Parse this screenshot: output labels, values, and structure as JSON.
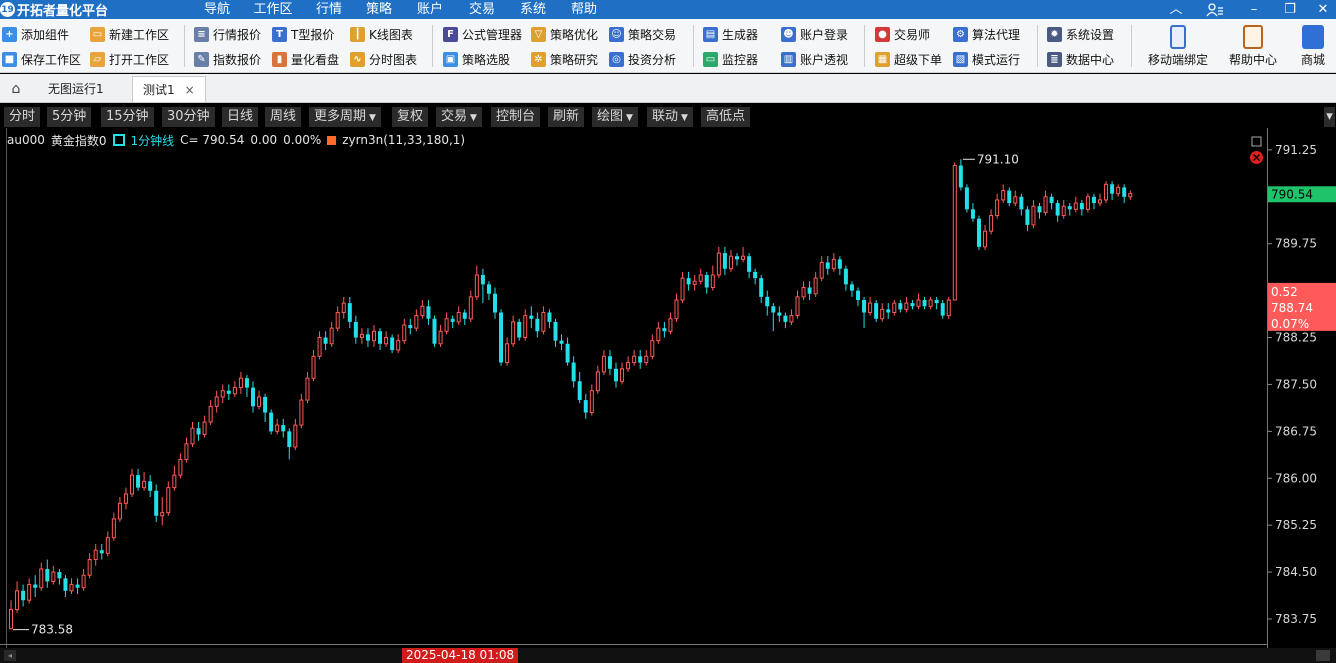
{
  "app": {
    "logo": "19",
    "title": "开拓者量化平台"
  },
  "menu": [
    {
      "label": "导航",
      "active": true
    },
    {
      "label": "工作区",
      "active": false
    },
    {
      "label": "行情",
      "active": false
    },
    {
      "label": "策略",
      "active": false
    },
    {
      "label": "账户",
      "active": false
    },
    {
      "label": "交易",
      "active": false
    },
    {
      "label": "系统",
      "active": false
    },
    {
      "label": "帮助",
      "active": false
    }
  ],
  "ribbon": {
    "add_component": "添加组件",
    "save_workspace": "保存工作区",
    "new_workspace": "新建工作区",
    "open_workspace": "打开工作区",
    "quote_report": "行情报价",
    "index_quote": "指数报价",
    "t_quote": "T型报价",
    "quant_board": "量化看盘",
    "kline_chart": "K线图表",
    "time_chart": "分时图表",
    "formula_manager": "公式管理器",
    "strategy_pick": "策略选股",
    "strategy_optimize": "策略优化",
    "strategy_research": "策略研究",
    "strategy_trade": "策略交易",
    "invest_analysis": "投资分析",
    "generator": "生成器",
    "monitor": "监控器",
    "account_login": "账户登录",
    "account_view": "账户透视",
    "trader": "交易师",
    "super_order": "超级下单",
    "algo_agent": "算法代理",
    "mode_run": "模式运行",
    "system_settings": "系统设置",
    "data_center": "数据中心",
    "mobile_bind": "移动端绑定",
    "help_center": "帮助中心",
    "store": "商城"
  },
  "tabs": [
    {
      "label": "无图运行1",
      "active": false
    },
    {
      "label": "测试1",
      "active": true,
      "close": "×"
    }
  ],
  "chart_toolbar": [
    "分时",
    "5分钟",
    "15分钟",
    "30分钟",
    "日线",
    "周线",
    "更多周期",
    "复权",
    "交易",
    "控制台",
    "刷新",
    "绘图",
    "联动",
    "高低点"
  ],
  "dropdown_marker": "▼",
  "info": {
    "symbol": "au000",
    "name": "黄金指数0",
    "period": "1分钟线",
    "close_label": "C= 790.54",
    "change": "0.00",
    "change_pct": "0.00%",
    "indicator": "zyrn3n(11,33,180,1)"
  },
  "colors": {
    "up": "#ff5a5a",
    "down": "#23e0e8",
    "last_price_bg": "#1fc46a",
    "cursor_box_bg": "#ff5a5a",
    "date_badge": "#d21c1c"
  },
  "chart_data": {
    "type": "candlestick",
    "x_label_visible": "2025-04-18 01:08",
    "ylim": [
      783.35,
      791.6
    ],
    "yticks": [
      "791.25",
      "789.75",
      "788.25",
      "787.50",
      "786.75",
      "786.00",
      "785.25",
      "784.50",
      "783.75"
    ],
    "ytick_values": [
      791.25,
      789.75,
      788.25,
      787.5,
      786.75,
      786.0,
      785.25,
      784.5,
      783.75
    ],
    "last_price": "790.54",
    "last_price_value": 790.54,
    "cursor_box": [
      "0.52",
      "788.74",
      "0.07%"
    ],
    "cursor_value": 788.74,
    "high_label": "791.10",
    "high_value": 791.1,
    "low_label": "783.58",
    "low_value": 783.58,
    "candles": [
      [
        783.6,
        783.9,
        783.58,
        784.05
      ],
      [
        783.9,
        784.2,
        783.85,
        784.35
      ],
      [
        784.2,
        784.05,
        783.95,
        784.3
      ],
      [
        784.05,
        784.3,
        784.0,
        784.4
      ],
      [
        784.3,
        784.25,
        784.1,
        784.45
      ],
      [
        784.25,
        784.55,
        784.2,
        784.65
      ],
      [
        784.55,
        784.35,
        784.25,
        784.7
      ],
      [
        784.35,
        784.5,
        784.3,
        784.6
      ],
      [
        784.5,
        784.4,
        784.3,
        784.55
      ],
      [
        784.4,
        784.2,
        784.1,
        784.45
      ],
      [
        784.2,
        784.3,
        784.15,
        784.4
      ],
      [
        784.3,
        784.25,
        784.15,
        784.4
      ],
      [
        784.25,
        784.45,
        784.2,
        784.55
      ],
      [
        784.45,
        784.7,
        784.4,
        784.8
      ],
      [
        784.7,
        784.85,
        784.6,
        784.95
      ],
      [
        784.85,
        784.8,
        784.7,
        784.95
      ],
      [
        784.8,
        785.05,
        784.75,
        785.15
      ],
      [
        785.05,
        785.35,
        785.0,
        785.45
      ],
      [
        785.35,
        785.6,
        785.3,
        785.7
      ],
      [
        785.6,
        785.75,
        785.5,
        785.85
      ],
      [
        785.75,
        786.05,
        785.7,
        786.15
      ],
      [
        786.05,
        785.85,
        785.8,
        786.15
      ],
      [
        785.85,
        785.95,
        785.8,
        786.1
      ],
      [
        785.95,
        785.8,
        785.7,
        786.05
      ],
      [
        785.8,
        785.4,
        785.3,
        785.9
      ],
      [
        785.4,
        785.45,
        785.25,
        785.7
      ],
      [
        785.45,
        785.85,
        785.4,
        785.95
      ],
      [
        785.85,
        786.05,
        785.8,
        786.2
      ],
      [
        786.05,
        786.3,
        786.0,
        786.4
      ],
      [
        786.3,
        786.55,
        786.25,
        786.65
      ],
      [
        786.55,
        786.8,
        786.5,
        786.9
      ],
      [
        786.8,
        786.7,
        786.6,
        786.9
      ],
      [
        786.7,
        786.9,
        786.65,
        787.0
      ],
      [
        786.9,
        787.15,
        786.85,
        787.25
      ],
      [
        787.15,
        787.3,
        787.05,
        787.4
      ],
      [
        787.3,
        787.4,
        787.2,
        787.5
      ],
      [
        787.4,
        787.35,
        787.25,
        787.5
      ],
      [
        787.35,
        787.45,
        787.3,
        787.55
      ],
      [
        787.45,
        787.6,
        787.35,
        787.7
      ],
      [
        787.6,
        787.45,
        787.3,
        787.65
      ],
      [
        787.45,
        787.15,
        787.05,
        787.55
      ],
      [
        787.15,
        787.3,
        787.1,
        787.4
      ],
      [
        787.3,
        787.05,
        786.9,
        787.35
      ],
      [
        787.05,
        786.75,
        786.7,
        787.1
      ],
      [
        786.75,
        786.85,
        786.7,
        786.95
      ],
      [
        786.85,
        786.75,
        786.65,
        786.95
      ],
      [
        786.75,
        786.5,
        786.3,
        786.8
      ],
      [
        786.5,
        786.85,
        786.45,
        786.95
      ],
      [
        786.85,
        787.25,
        786.8,
        787.35
      ],
      [
        787.25,
        787.6,
        787.2,
        787.7
      ],
      [
        787.6,
        787.95,
        787.55,
        788.05
      ],
      [
        787.95,
        788.25,
        787.9,
        788.35
      ],
      [
        788.25,
        788.15,
        788.05,
        788.35
      ],
      [
        788.15,
        788.4,
        788.1,
        788.5
      ],
      [
        788.4,
        788.65,
        788.35,
        788.75
      ],
      [
        788.65,
        788.8,
        788.55,
        788.9
      ],
      [
        788.8,
        788.5,
        788.4,
        788.9
      ],
      [
        788.5,
        788.25,
        788.15,
        788.6
      ],
      [
        788.25,
        788.3,
        788.15,
        788.4
      ],
      [
        788.3,
        788.2,
        788.1,
        788.4
      ],
      [
        788.2,
        788.35,
        788.1,
        788.45
      ],
      [
        788.35,
        788.15,
        788.05,
        788.4
      ],
      [
        788.15,
        788.25,
        788.1,
        788.35
      ],
      [
        788.25,
        788.05,
        788.0,
        788.3
      ],
      [
        788.05,
        788.2,
        788.0,
        788.3
      ],
      [
        788.2,
        788.45,
        788.15,
        788.55
      ],
      [
        788.45,
        788.4,
        788.3,
        788.55
      ],
      [
        788.4,
        788.6,
        788.35,
        788.7
      ],
      [
        788.6,
        788.75,
        788.55,
        788.85
      ],
      [
        788.75,
        788.55,
        788.45,
        788.85
      ],
      [
        788.55,
        788.15,
        788.1,
        788.6
      ],
      [
        788.15,
        788.35,
        788.1,
        788.45
      ],
      [
        788.35,
        788.55,
        788.3,
        788.65
      ],
      [
        788.55,
        788.5,
        788.4,
        788.6
      ],
      [
        788.5,
        788.65,
        788.45,
        788.75
      ],
      [
        788.65,
        788.55,
        788.45,
        788.7
      ],
      [
        788.55,
        788.9,
        788.5,
        789.0
      ],
      [
        788.9,
        789.25,
        788.85,
        789.4
      ],
      [
        789.25,
        789.1,
        788.8,
        789.35
      ],
      [
        789.1,
        788.95,
        788.85,
        789.15
      ],
      [
        788.95,
        788.65,
        788.55,
        789.05
      ],
      [
        788.65,
        787.85,
        787.8,
        788.7
      ],
      [
        787.85,
        788.15,
        787.8,
        788.25
      ],
      [
        788.15,
        788.5,
        788.1,
        788.6
      ],
      [
        788.5,
        788.25,
        788.2,
        788.55
      ],
      [
        788.25,
        788.6,
        788.2,
        788.7
      ],
      [
        788.6,
        788.55,
        788.4,
        788.75
      ],
      [
        788.55,
        788.35,
        788.25,
        788.65
      ],
      [
        788.35,
        788.65,
        788.3,
        788.75
      ],
      [
        788.65,
        788.5,
        788.4,
        788.7
      ],
      [
        788.5,
        788.2,
        788.1,
        788.55
      ],
      [
        788.2,
        788.15,
        788.05,
        788.3
      ],
      [
        788.15,
        787.85,
        787.8,
        788.25
      ],
      [
        787.85,
        787.55,
        787.45,
        787.95
      ],
      [
        787.55,
        787.25,
        787.2,
        787.7
      ],
      [
        787.25,
        787.05,
        786.95,
        787.35
      ],
      [
        787.05,
        787.4,
        787.0,
        787.5
      ],
      [
        787.4,
        787.7,
        787.35,
        787.8
      ],
      [
        787.7,
        787.95,
        787.65,
        788.05
      ],
      [
        787.95,
        787.75,
        787.65,
        788.05
      ],
      [
        787.75,
        787.55,
        787.45,
        787.85
      ],
      [
        787.55,
        787.75,
        787.5,
        787.85
      ],
      [
        787.75,
        787.85,
        787.7,
        787.95
      ],
      [
        787.85,
        787.95,
        787.8,
        788.05
      ],
      [
        787.95,
        787.85,
        787.75,
        788.05
      ],
      [
        787.85,
        787.95,
        787.8,
        788.05
      ],
      [
        787.95,
        788.2,
        787.9,
        788.3
      ],
      [
        788.2,
        788.4,
        788.15,
        788.5
      ],
      [
        788.4,
        788.35,
        788.25,
        788.5
      ],
      [
        788.35,
        788.55,
        788.3,
        788.65
      ],
      [
        788.55,
        788.85,
        788.5,
        788.95
      ],
      [
        788.85,
        789.2,
        788.8,
        789.3
      ],
      [
        789.2,
        789.1,
        789.0,
        789.3
      ],
      [
        789.1,
        789.15,
        789.0,
        789.25
      ],
      [
        789.15,
        789.25,
        789.1,
        789.35
      ],
      [
        789.25,
        789.05,
        788.95,
        789.3
      ],
      [
        789.05,
        789.25,
        789.0,
        789.4
      ],
      [
        789.25,
        789.6,
        789.2,
        789.7
      ],
      [
        789.6,
        789.35,
        789.25,
        789.7
      ],
      [
        789.35,
        789.55,
        789.3,
        789.65
      ],
      [
        789.55,
        789.5,
        789.4,
        789.6
      ],
      [
        789.5,
        789.55,
        789.45,
        789.7
      ],
      [
        789.55,
        789.3,
        789.2,
        789.6
      ],
      [
        789.3,
        789.2,
        789.1,
        789.35
      ],
      [
        789.2,
        788.9,
        788.8,
        789.25
      ],
      [
        788.9,
        788.75,
        788.6,
        789.0
      ],
      [
        788.75,
        788.65,
        788.35,
        788.8
      ],
      [
        788.65,
        788.6,
        788.5,
        788.75
      ],
      [
        788.6,
        788.5,
        788.4,
        788.65
      ],
      [
        788.5,
        788.6,
        788.45,
        788.7
      ],
      [
        788.6,
        788.9,
        788.55,
        789.0
      ],
      [
        788.9,
        789.05,
        788.85,
        789.15
      ],
      [
        789.05,
        788.95,
        788.85,
        789.15
      ],
      [
        788.95,
        789.2,
        788.9,
        789.3
      ],
      [
        789.2,
        789.45,
        789.15,
        789.55
      ],
      [
        789.45,
        789.35,
        789.25,
        789.55
      ],
      [
        789.35,
        789.5,
        789.3,
        789.6
      ],
      [
        789.5,
        789.35,
        789.25,
        789.55
      ],
      [
        789.35,
        789.1,
        789.0,
        789.4
      ],
      [
        789.1,
        789.0,
        788.9,
        789.15
      ],
      [
        789.0,
        788.85,
        788.75,
        789.05
      ],
      [
        788.85,
        788.65,
        788.4,
        788.9
      ],
      [
        788.65,
        788.8,
        788.6,
        788.9
      ],
      [
        788.8,
        788.55,
        788.5,
        788.85
      ],
      [
        788.55,
        788.7,
        788.5,
        788.8
      ],
      [
        788.7,
        788.65,
        788.55,
        788.8
      ],
      [
        788.65,
        788.8,
        788.6,
        788.85
      ],
      [
        788.8,
        788.7,
        788.65,
        788.85
      ],
      [
        788.7,
        788.8,
        788.65,
        788.9
      ],
      [
        788.8,
        788.75,
        788.7,
        788.85
      ],
      [
        788.75,
        788.85,
        788.7,
        788.95
      ],
      [
        788.85,
        788.75,
        788.7,
        788.9
      ],
      [
        788.75,
        788.85,
        788.7,
        788.9
      ],
      [
        788.85,
        788.8,
        788.7,
        788.9
      ],
      [
        788.8,
        788.6,
        788.55,
        788.85
      ],
      [
        788.6,
        788.85,
        788.55,
        788.9
      ],
      [
        788.85,
        791.0,
        788.85,
        791.05
      ],
      [
        791.0,
        790.65,
        790.6,
        791.1
      ],
      [
        790.65,
        790.3,
        790.25,
        790.7
      ],
      [
        790.3,
        790.15,
        790.1,
        790.4
      ],
      [
        790.15,
        789.7,
        789.65,
        790.2
      ],
      [
        789.7,
        789.95,
        789.65,
        790.05
      ],
      [
        789.95,
        790.2,
        789.9,
        790.3
      ],
      [
        790.2,
        790.45,
        790.15,
        790.55
      ],
      [
        790.45,
        790.6,
        790.4,
        790.7
      ],
      [
        790.6,
        790.4,
        790.35,
        790.65
      ],
      [
        790.4,
        790.5,
        790.35,
        790.6
      ],
      [
        790.5,
        790.3,
        790.2,
        790.55
      ],
      [
        790.3,
        790.05,
        789.95,
        790.35
      ],
      [
        790.05,
        790.35,
        790.0,
        790.45
      ],
      [
        790.35,
        790.25,
        790.15,
        790.4
      ],
      [
        790.25,
        790.5,
        790.2,
        790.6
      ],
      [
        790.5,
        790.4,
        790.3,
        790.55
      ],
      [
        790.4,
        790.2,
        790.1,
        790.45
      ],
      [
        790.2,
        790.35,
        790.15,
        790.45
      ],
      [
        790.35,
        790.3,
        790.2,
        790.4
      ],
      [
        790.3,
        790.4,
        790.25,
        790.5
      ],
      [
        790.4,
        790.3,
        790.2,
        790.45
      ],
      [
        790.3,
        790.5,
        790.25,
        790.55
      ],
      [
        790.5,
        790.4,
        790.3,
        790.55
      ],
      [
        790.4,
        790.45,
        790.35,
        790.55
      ],
      [
        790.45,
        790.7,
        790.4,
        790.75
      ],
      [
        790.7,
        790.55,
        790.45,
        790.75
      ],
      [
        790.55,
        790.65,
        790.5,
        790.7
      ],
      [
        790.65,
        790.5,
        790.4,
        790.7
      ],
      [
        790.5,
        790.55,
        790.45,
        790.6
      ]
    ]
  }
}
